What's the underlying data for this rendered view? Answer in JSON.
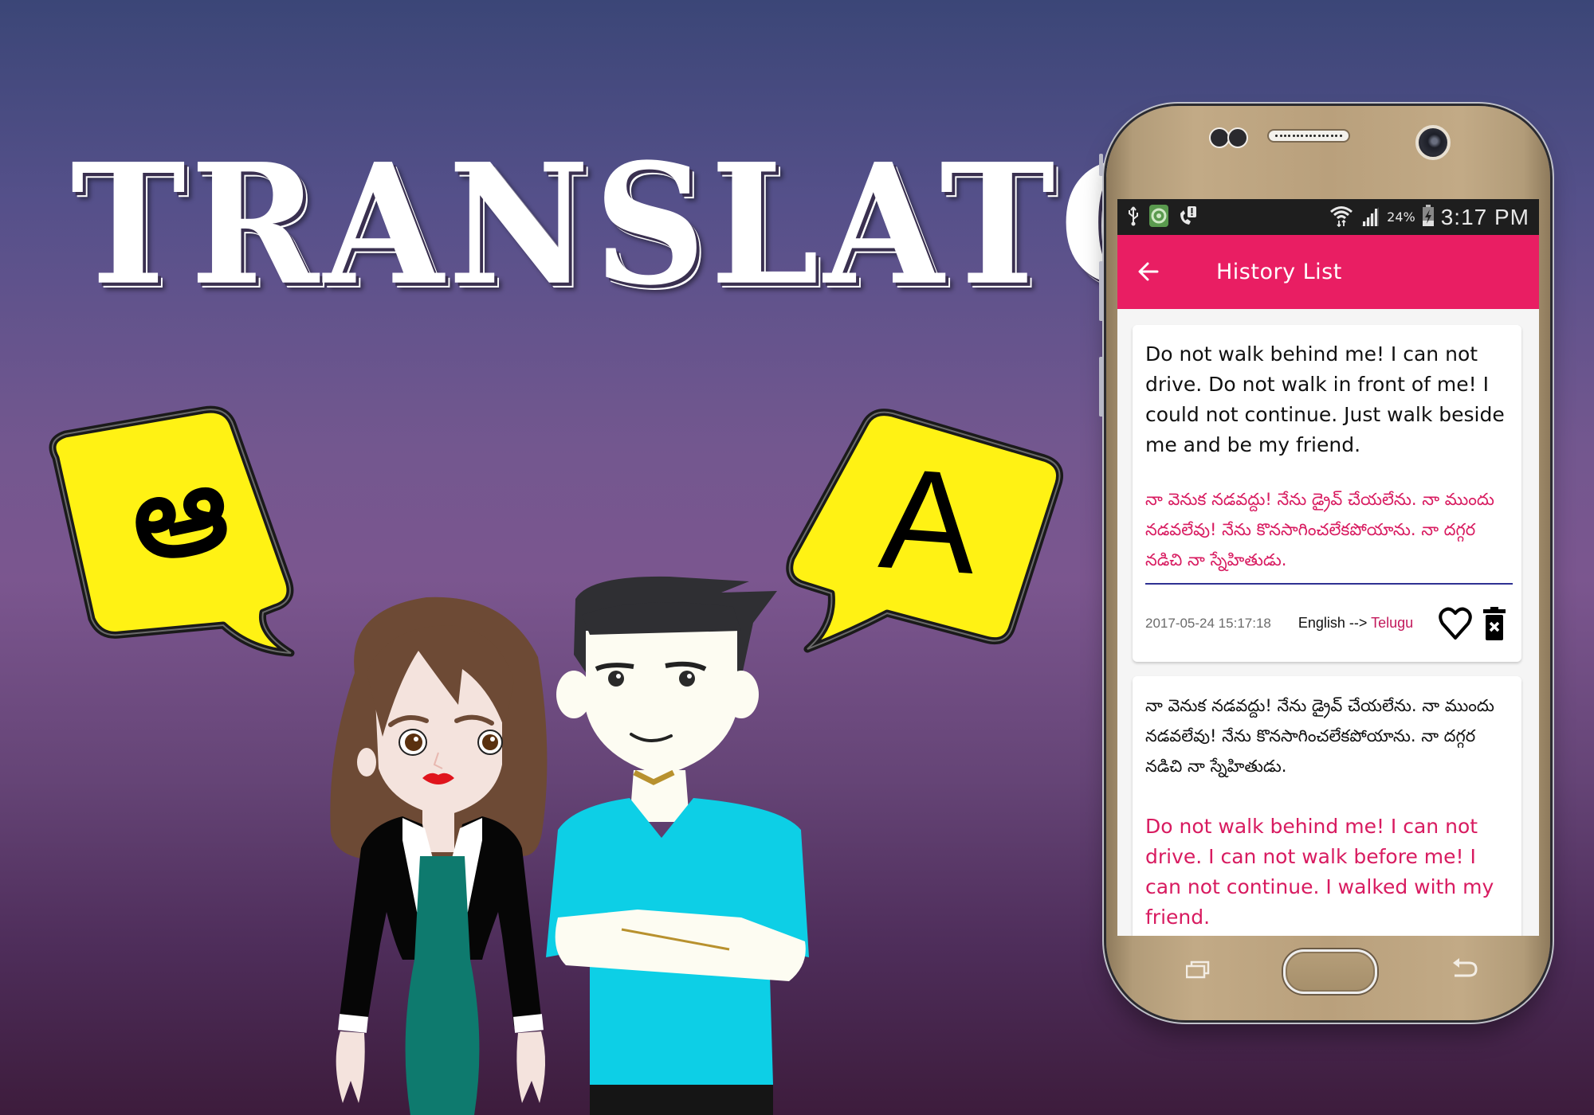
{
  "banner": {
    "title": "TRANSLATOR",
    "source_bubble_glyph": "ఆ",
    "target_bubble_glyph": "A"
  },
  "colors": {
    "accent": "#e91e63",
    "translation_text": "#d81b60",
    "divider": "#2e3192",
    "bubble_fill": "#fff214",
    "status_bar": "#1e1e1e"
  },
  "status_bar": {
    "icons_left": [
      "usb-icon",
      "app-notification-icon",
      "missed-call-alert-icon"
    ],
    "icons_right": [
      "wifi-icon",
      "signal-icon",
      "battery-charging-icon"
    ],
    "battery": "24%",
    "time": "3:17 PM"
  },
  "app_bar": {
    "back_icon": "arrow-left-icon",
    "title": "History List"
  },
  "history": [
    {
      "source_text": "Do not walk behind me! I can not drive. Do not walk in front of me! I could not continue. Just walk beside me and be my friend.",
      "translated_text": "నా వెనుక నడవద్దు! నేను డ్రైవ్ చేయలేను. నా ముందు నడవలేవు! నేను కొనసాగించలేకపోయాను. నా దగ్గర నడిచి నా స్నేహితుడు.",
      "timestamp": "2017-05-24 15:17:18",
      "from_lang": "English",
      "arrow": "-->",
      "to_lang": "Telugu",
      "favorite_icon": "heart-outline-icon",
      "delete_icon": "trash-delete-icon"
    },
    {
      "source_text": "నా వెనుక నడవద్దు! నేను డ్రైవ్ చేయలేను. నా ముందు నడవలేవు! నేను కొనసాగించలేకపోయాను. నా దగ్గర నడిచి నా స్నేహితుడు.",
      "translated_text": "Do not walk behind me! I can not drive. I can not walk before me! I can not continue. I walked with my friend.",
      "favorite_icon": "heart-filled-icon",
      "delete_icon": "trash-delete-icon"
    }
  ],
  "nav_keys": {
    "recent": "recent-apps-icon",
    "home": "home-button",
    "back": "back-arrow-icon"
  }
}
